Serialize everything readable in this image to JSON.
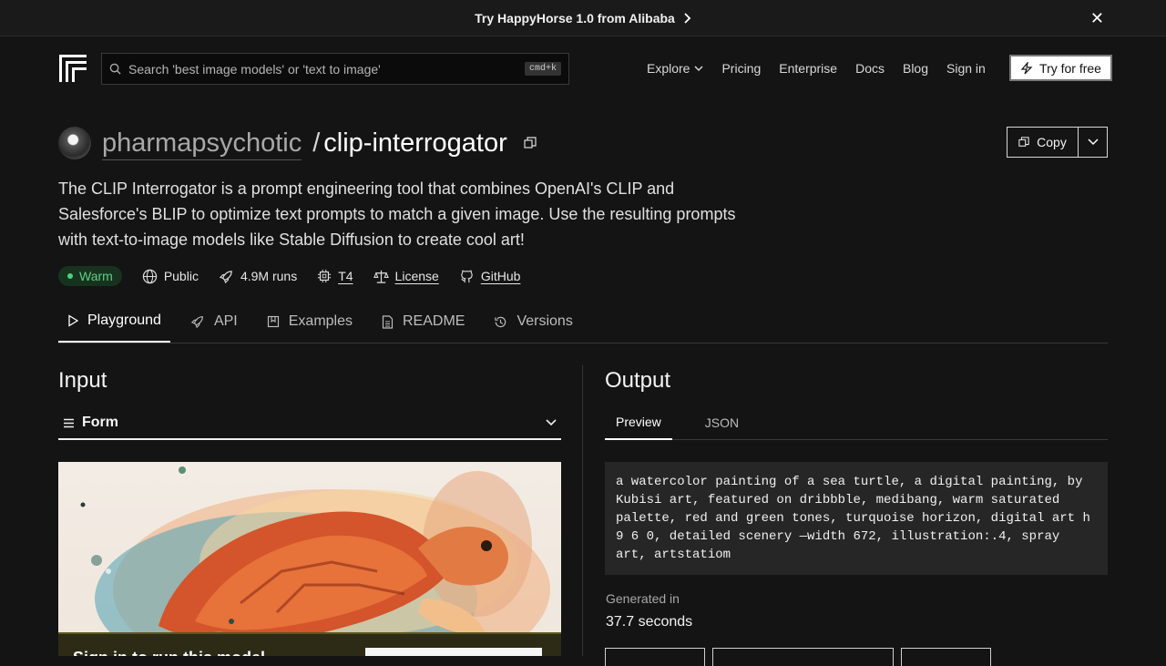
{
  "banner": {
    "text": "Try HappyHorse 1.0 from Alibaba"
  },
  "nav": {
    "search_placeholder": "Search 'best image models' or 'text to image'",
    "shortcut": "cmd+k",
    "links": [
      "Explore",
      "Pricing",
      "Enterprise",
      "Docs",
      "Blog",
      "Sign in"
    ],
    "cta": "Try for free"
  },
  "model": {
    "owner": "pharmapsychotic",
    "name": "clip-interrogator",
    "description": "The CLIP Interrogator is a prompt engineering tool that combines OpenAI's CLIP and Salesforce's BLIP to optimize text prompts to match a given image. Use the resulting prompts with text-to-image models like Stable Diffusion to create cool art!",
    "copy_label": "Copy",
    "status": "Warm",
    "visibility": "Public",
    "runs": "4.9M runs",
    "hardware": "T4",
    "license": "License",
    "github": "GitHub"
  },
  "tabs": [
    "Playground",
    "API",
    "Examples",
    "README",
    "Versions"
  ],
  "input": {
    "title": "Input",
    "form_label": "Form",
    "overlay_text": "Sign in to run this model"
  },
  "output": {
    "title": "Output",
    "tabs": [
      "Preview",
      "JSON"
    ],
    "text": "a watercolor painting of a sea turtle, a digital painting, by Kubisi art, featured on dribbble, medibang, warm saturated palette, red and green tones, turquoise horizon, digital art h 9 6 0, detailed scenery —width 672, illustration:.4, spray art, artstatiom",
    "generated_label": "Generated in",
    "generated_value": "37.7 seconds"
  }
}
